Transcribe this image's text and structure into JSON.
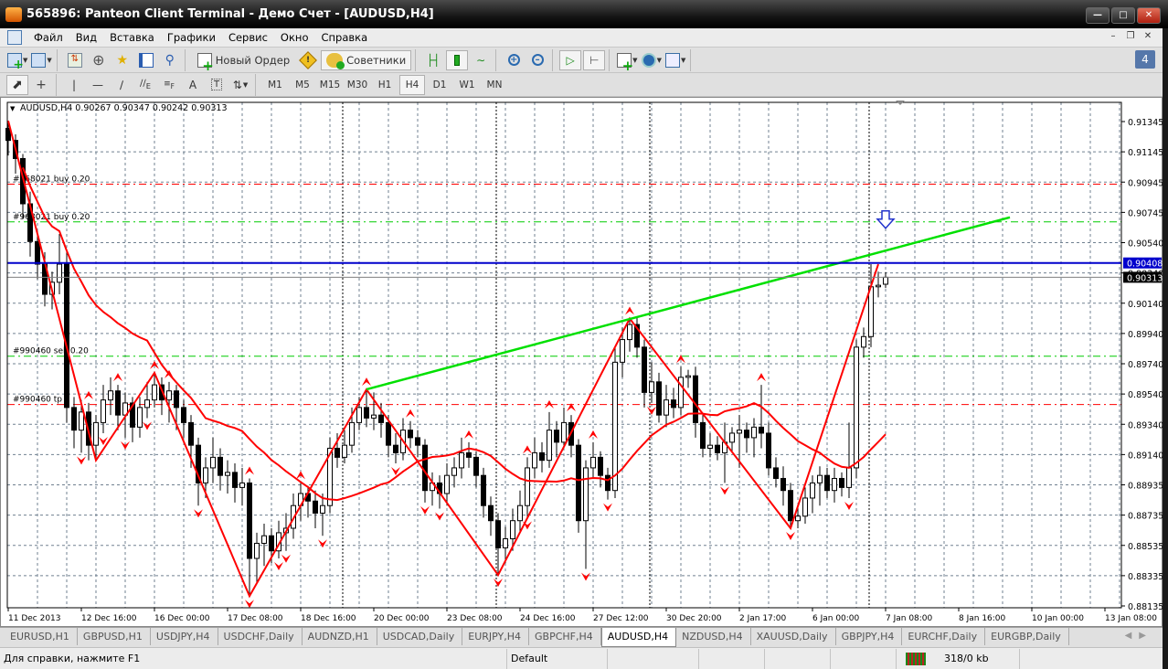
{
  "window": {
    "title": "565896: Panteon Client Terminal - Демо Счет - [AUDUSD,H4]"
  },
  "menu": {
    "items": [
      "Файл",
      "Вид",
      "Вставка",
      "Графики",
      "Сервис",
      "Окно",
      "Справка"
    ]
  },
  "toolbar": {
    "new_order_label": "Новый Ордер",
    "experts_label": "Советники",
    "notifications_count": "4",
    "timeframes": [
      "M1",
      "M5",
      "M15",
      "M30",
      "H1",
      "H4",
      "D1",
      "W1",
      "MN"
    ],
    "active_timeframe": "H4",
    "chart_mode": "candlesticks"
  },
  "chart_header": "AUDUSD,H4  0.90267 0.90347 0.90242 0.90313",
  "colors": {
    "bull_body": "#ffffff",
    "bear_body": "#000000",
    "ma": "#ff0000",
    "zigzag": "#ff0000",
    "trendline": "#00e000",
    "resistance": "#0000cc",
    "bid": "#808080",
    "signal_arrow": "#2233cc",
    "grid": "#708090"
  },
  "chart_data": {
    "type": "candlestick",
    "symbol": "AUDUSD",
    "timeframe": "H4",
    "ylim": [
      0.88135,
      0.91345
    ],
    "grid": true,
    "price_ticks": [
      "0.91345",
      "0.91145",
      "0.90945",
      "0.90745",
      "0.90540",
      "0.90340",
      "0.90140",
      "0.89940",
      "0.89740",
      "0.89540",
      "0.89340",
      "0.89140",
      "0.88935",
      "0.88735",
      "0.88535",
      "0.88335",
      "0.88135"
    ],
    "time_ticks": [
      "11 Dec 2013",
      "12 Dec 16:00",
      "16 Dec 00:00",
      "17 Dec 08:00",
      "18 Dec 16:00",
      "20 Dec 00:00",
      "23 Dec 08:00",
      "24 Dec 16:00",
      "27 Dec 12:00",
      "30 Dec 20:00",
      "2 Jan 17:00",
      "6 Jan 00:00",
      "7 Jan 08:00",
      "8 Jan 16:00",
      "10 Jan 00:00",
      "13 Jan 08:00"
    ],
    "candles": [
      [
        0.913,
        0.9135,
        0.9112,
        0.9122
      ],
      [
        0.9122,
        0.9126,
        0.91,
        0.911
      ],
      [
        0.911,
        0.9113,
        0.907,
        0.908
      ],
      [
        0.908,
        0.9088,
        0.9045,
        0.9055
      ],
      [
        0.9055,
        0.9062,
        0.903,
        0.904
      ],
      [
        0.904,
        0.9048,
        0.9012,
        0.902
      ],
      [
        0.902,
        0.9035,
        0.901,
        0.9028
      ],
      [
        0.9028,
        0.906,
        0.902,
        0.904
      ],
      [
        0.904,
        0.9048,
        0.8935,
        0.8945
      ],
      [
        0.8945,
        0.8952,
        0.8918,
        0.893
      ],
      [
        0.893,
        0.895,
        0.8915,
        0.8942
      ],
      [
        0.8942,
        0.8948,
        0.891,
        0.892
      ],
      [
        0.892,
        0.894,
        0.891,
        0.8935
      ],
      [
        0.8935,
        0.896,
        0.8928,
        0.895
      ],
      [
        0.895,
        0.8965,
        0.894,
        0.8956
      ],
      [
        0.8956,
        0.896,
        0.893,
        0.894
      ],
      [
        0.894,
        0.8955,
        0.8925,
        0.8948
      ],
      [
        0.8948,
        0.8952,
        0.8922,
        0.8932
      ],
      [
        0.8932,
        0.8952,
        0.8925,
        0.8945
      ],
      [
        0.8945,
        0.8962,
        0.8938,
        0.895
      ],
      [
        0.895,
        0.8968,
        0.8945,
        0.896
      ],
      [
        0.896,
        0.8965,
        0.894,
        0.895
      ],
      [
        0.895,
        0.8962,
        0.8935,
        0.8956
      ],
      [
        0.8956,
        0.896,
        0.893,
        0.8945
      ],
      [
        0.8945,
        0.895,
        0.8925,
        0.8935
      ],
      [
        0.8935,
        0.894,
        0.8905,
        0.892
      ],
      [
        0.892,
        0.8925,
        0.888,
        0.8895
      ],
      [
        0.8895,
        0.8912,
        0.8885,
        0.8905
      ],
      [
        0.8905,
        0.8925,
        0.8895,
        0.8912
      ],
      [
        0.8912,
        0.8918,
        0.889,
        0.89
      ],
      [
        0.89,
        0.891,
        0.8888,
        0.8902
      ],
      [
        0.8902,
        0.8908,
        0.8882,
        0.8892
      ],
      [
        0.8892,
        0.8905,
        0.888,
        0.8895
      ],
      [
        0.8895,
        0.8898,
        0.882,
        0.8845
      ],
      [
        0.8845,
        0.8862,
        0.8828,
        0.8855
      ],
      [
        0.8855,
        0.8868,
        0.884,
        0.886
      ],
      [
        0.886,
        0.8865,
        0.8842,
        0.885
      ],
      [
        0.885,
        0.887,
        0.8845,
        0.8862
      ],
      [
        0.8862,
        0.8875,
        0.885,
        0.8865
      ],
      [
        0.8865,
        0.8888,
        0.8858,
        0.888
      ],
      [
        0.888,
        0.8895,
        0.887,
        0.8888
      ],
      [
        0.8888,
        0.8893,
        0.8872,
        0.8883
      ],
      [
        0.8883,
        0.889,
        0.8865,
        0.8875
      ],
      [
        0.8875,
        0.8888,
        0.886,
        0.888
      ],
      [
        0.888,
        0.8925,
        0.8875,
        0.8918
      ],
      [
        0.8918,
        0.8928,
        0.8905,
        0.8912
      ],
      [
        0.8912,
        0.893,
        0.8908,
        0.892
      ],
      [
        0.892,
        0.8945,
        0.8915,
        0.8935
      ],
      [
        0.8935,
        0.8952,
        0.893,
        0.8945
      ],
      [
        0.8945,
        0.8957,
        0.8932,
        0.8938
      ],
      [
        0.8938,
        0.8955,
        0.893,
        0.894
      ],
      [
        0.894,
        0.8948,
        0.8925,
        0.8935
      ],
      [
        0.8935,
        0.894,
        0.8912,
        0.892
      ],
      [
        0.892,
        0.8928,
        0.8908,
        0.8915
      ],
      [
        0.8915,
        0.8938,
        0.891,
        0.893
      ],
      [
        0.893,
        0.8936,
        0.8918,
        0.8925
      ],
      [
        0.8925,
        0.893,
        0.8912,
        0.892
      ],
      [
        0.892,
        0.8924,
        0.8882,
        0.889
      ],
      [
        0.889,
        0.8902,
        0.888,
        0.8895
      ],
      [
        0.8895,
        0.89,
        0.8878,
        0.8888
      ],
      [
        0.8888,
        0.8908,
        0.888,
        0.89
      ],
      [
        0.89,
        0.8912,
        0.8892,
        0.8905
      ],
      [
        0.8905,
        0.8925,
        0.8898,
        0.8915
      ],
      [
        0.8915,
        0.8922,
        0.8905,
        0.8912
      ],
      [
        0.8912,
        0.8916,
        0.8892,
        0.89
      ],
      [
        0.89,
        0.8905,
        0.8872,
        0.888
      ],
      [
        0.888,
        0.8886,
        0.886,
        0.887
      ],
      [
        0.887,
        0.8875,
        0.8834,
        0.8852
      ],
      [
        0.8852,
        0.8866,
        0.8842,
        0.8858
      ],
      [
        0.8858,
        0.8878,
        0.885,
        0.887
      ],
      [
        0.887,
        0.889,
        0.8862,
        0.888
      ],
      [
        0.888,
        0.8912,
        0.8872,
        0.8905
      ],
      [
        0.8905,
        0.8925,
        0.8898,
        0.8915
      ],
      [
        0.8915,
        0.8922,
        0.8902,
        0.891
      ],
      [
        0.891,
        0.8942,
        0.8905,
        0.893
      ],
      [
        0.893,
        0.8936,
        0.8912,
        0.8922
      ],
      [
        0.8922,
        0.8945,
        0.8918,
        0.8935
      ],
      [
        0.8935,
        0.894,
        0.8912,
        0.892
      ],
      [
        0.892,
        0.8924,
        0.8862,
        0.887
      ],
      [
        0.887,
        0.891,
        0.8838,
        0.8905
      ],
      [
        0.8905,
        0.8922,
        0.8898,
        0.8912
      ],
      [
        0.8912,
        0.8916,
        0.8892,
        0.89
      ],
      [
        0.89,
        0.8905,
        0.8884,
        0.889
      ],
      [
        0.889,
        0.8985,
        0.8885,
        0.8975
      ],
      [
        0.8975,
        0.8998,
        0.8965,
        0.899
      ],
      [
        0.899,
        0.9004,
        0.8982,
        0.9
      ],
      [
        0.9,
        0.9005,
        0.8978,
        0.8985
      ],
      [
        0.8985,
        0.899,
        0.8945,
        0.8955
      ],
      [
        0.8955,
        0.8975,
        0.8948,
        0.8962
      ],
      [
        0.8962,
        0.8968,
        0.8935,
        0.894
      ],
      [
        0.894,
        0.896,
        0.8932,
        0.895
      ],
      [
        0.895,
        0.8958,
        0.8938,
        0.8945
      ],
      [
        0.8945,
        0.8972,
        0.894,
        0.8965
      ],
      [
        0.8965,
        0.897,
        0.8958,
        0.8966
      ],
      [
        0.8966,
        0.8972,
        0.8925,
        0.8935
      ],
      [
        0.8935,
        0.894,
        0.8912,
        0.8918
      ],
      [
        0.8918,
        0.8928,
        0.8912,
        0.892
      ],
      [
        0.892,
        0.8926,
        0.891,
        0.8915
      ],
      [
        0.8915,
        0.8935,
        0.8895,
        0.8922
      ],
      [
        0.8922,
        0.8932,
        0.8915,
        0.8928
      ],
      [
        0.8928,
        0.894,
        0.8905,
        0.893
      ],
      [
        0.893,
        0.8935,
        0.8915,
        0.8925
      ],
      [
        0.8925,
        0.8938,
        0.8912,
        0.8932
      ],
      [
        0.8932,
        0.896,
        0.8918,
        0.8928
      ],
      [
        0.8928,
        0.8935,
        0.89,
        0.8905
      ],
      [
        0.8905,
        0.8912,
        0.8892,
        0.8898
      ],
      [
        0.8898,
        0.8906,
        0.888,
        0.889
      ],
      [
        0.889,
        0.8895,
        0.8865,
        0.887
      ],
      [
        0.887,
        0.888,
        0.8865,
        0.8873
      ],
      [
        0.8873,
        0.8892,
        0.8868,
        0.8885
      ],
      [
        0.8885,
        0.89,
        0.8875,
        0.8895
      ],
      [
        0.8895,
        0.8906,
        0.888,
        0.89
      ],
      [
        0.89,
        0.8905,
        0.8885,
        0.889
      ],
      [
        0.889,
        0.8905,
        0.8882,
        0.8898
      ],
      [
        0.8898,
        0.8902,
        0.8886,
        0.8892
      ],
      [
        0.8892,
        0.8935,
        0.8885,
        0.8905
      ],
      [
        0.8905,
        0.899,
        0.8898,
        0.8985
      ],
      [
        0.8985,
        0.8998,
        0.8978,
        0.8992
      ],
      [
        0.8992,
        0.904,
        0.8985,
        0.9025
      ],
      [
        0.9025,
        0.9035,
        0.9018,
        0.9026
      ],
      [
        0.90267,
        0.90347,
        0.90242,
        0.90313
      ]
    ],
    "moving_average_period": 20,
    "zigzag": [
      [
        0,
        0.9135
      ],
      [
        12,
        0.891
      ],
      [
        20,
        0.8968
      ],
      [
        33,
        0.882
      ],
      [
        49,
        0.8957
      ],
      [
        67,
        0.8834
      ],
      [
        85,
        0.9004
      ],
      [
        107,
        0.8865
      ],
      [
        119,
        0.904
      ]
    ],
    "fractals_up": [
      11,
      15,
      20,
      22,
      33,
      40,
      49,
      55,
      63,
      71,
      74,
      77,
      80,
      85,
      92,
      103
    ],
    "fractals_down": [
      10,
      13,
      16,
      19,
      26,
      33,
      37,
      38,
      43,
      53,
      57,
      59,
      67,
      71,
      79,
      82,
      88,
      98,
      107,
      115
    ],
    "trendline": {
      "from": [
        49,
        0.8957
      ],
      "to": [
        137,
        0.9071
      ]
    },
    "signal_arrow": {
      "index": 120,
      "price": 0.9068,
      "direction": "down"
    },
    "horizontal_lines": [
      {
        "price": 0.90408,
        "label": "0.90408",
        "kind": "resistance"
      },
      {
        "price": 0.90313,
        "label": "0.90313",
        "kind": "bid"
      }
    ],
    "order_levels": [
      {
        "price": 0.9093,
        "label": "#968021 buy 0.20",
        "color": "#ff0000"
      },
      {
        "price": 0.9068,
        "label": "#968021 buy 0.20",
        "color": "#00cc00"
      },
      {
        "price": 0.8979,
        "label": "#990460 sell 0.20",
        "color": "#00cc00"
      },
      {
        "price": 0.8947,
        "label": "#990460 tp",
        "color": "#ff0000"
      }
    ]
  },
  "tabs": [
    "EURUSD,H1",
    "GBPUSD,H1",
    "USDJPY,H4",
    "USDCHF,Daily",
    "AUDNZD,H1",
    "USDCAD,Daily",
    "EURJPY,H4",
    "GBPCHF,H4",
    "AUDUSD,H4",
    "NZDUSD,H4",
    "XAUUSD,Daily",
    "GBPJPY,H4",
    "EURCHF,Daily",
    "EURGBP,Daily"
  ],
  "active_tab": "AUDUSD,H4",
  "status": {
    "help": "Для справки, нажмите F1",
    "profile": "Default",
    "traffic": "318/0 kb"
  }
}
